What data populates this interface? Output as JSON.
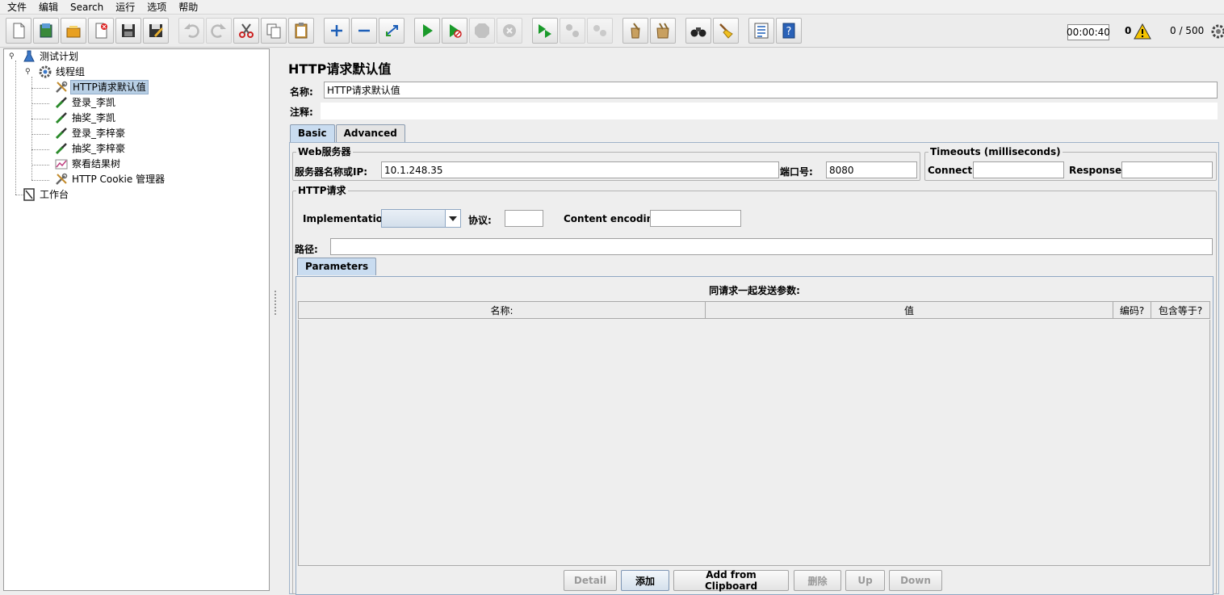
{
  "menu": [
    "文件",
    "编辑",
    "Search",
    "运行",
    "选项",
    "帮助"
  ],
  "toolbar": {
    "icons": [
      "new-icon",
      "templates-icon",
      "open-icon",
      "close-icon",
      "save-icon",
      "save-as-icon",
      "undo-icon",
      "redo-icon",
      "cut-icon",
      "copy-icon",
      "paste-icon",
      "expand-icon",
      "collapse-icon",
      "toggle-icon",
      "start-icon",
      "start-no-pause-icon",
      "stop-icon",
      "shutdown-icon",
      "remote-start-icon",
      "remote-stop-icon",
      "remote-shutdown-icon",
      "clear-icon",
      "clear-all-icon",
      "search-icon",
      "reset-search-icon",
      "function-helper-icon",
      "help-icon"
    ],
    "timer": "00:00:40",
    "error_count": "0",
    "threads": "0 / 500"
  },
  "tree": {
    "nodes": [
      {
        "label": "测试计划",
        "icon": "test-plan-icon"
      },
      {
        "label": "线程组",
        "icon": "thread-group-icon"
      },
      {
        "label": "HTTP请求默认值",
        "icon": "config-wrench-icon"
      },
      {
        "label": "登录_李凯",
        "icon": "sampler-pipette-icon"
      },
      {
        "label": "抽奖_李凯",
        "icon": "sampler-pipette-icon"
      },
      {
        "label": "登录_李梓豪",
        "icon": "sampler-pipette-icon"
      },
      {
        "label": "抽奖_李梓豪",
        "icon": "sampler-pipette-icon"
      },
      {
        "label": "察看结果树",
        "icon": "listener-chart-icon"
      },
      {
        "label": "HTTP Cookie 管理器",
        "icon": "config-wrench-icon"
      },
      {
        "label": "工作台",
        "icon": "workbench-icon"
      }
    ]
  },
  "panel": {
    "title": "HTTP请求默认值",
    "name_label": "名称:",
    "name_value": "HTTP请求默认值",
    "comment_label": "注释:",
    "comment_value": "",
    "tabs": [
      "Basic",
      "Advanced"
    ],
    "web_server": {
      "title": "Web服务器",
      "server_label": "服务器名称或IP:",
      "server_value": "10.1.248.35",
      "port_label": "端口号:",
      "port_value": "8080"
    },
    "timeouts": {
      "title": "Timeouts (milliseconds)",
      "connect_label": "Connect:",
      "connect_value": "",
      "response_label": "Response:",
      "response_value": ""
    },
    "http_request": {
      "title": "HTTP请求",
      "impl_label": "Implementation:",
      "impl_value": "",
      "protocol_label": "协议:",
      "protocol_value": "",
      "encoding_label": "Content encoding:",
      "encoding_value": "",
      "path_label": "路径:",
      "path_value": ""
    },
    "params": {
      "tab": "Parameters",
      "heading": "同请求一起发送参数:",
      "columns": [
        "名称:",
        "值",
        "编码?",
        "包含等于?"
      ],
      "rows": []
    },
    "buttons": {
      "detail": "Detail",
      "add": "添加",
      "add_clipboard": "Add from Clipboard",
      "delete": "删除",
      "up": "Up",
      "down": "Down"
    }
  },
  "colors": {
    "selection": "#b8cfe5",
    "active_tab": "#c9dcf0",
    "start_green": "#1a9a2a"
  }
}
